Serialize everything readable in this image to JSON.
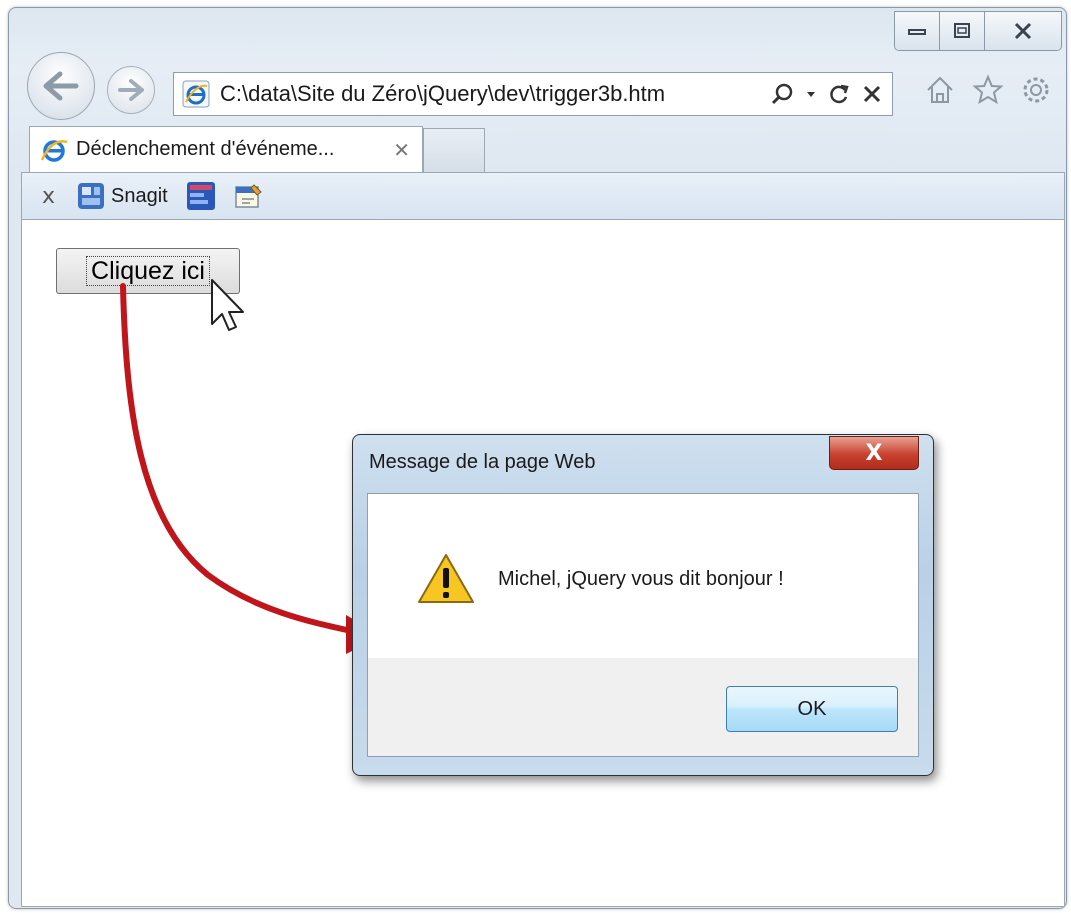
{
  "browser": {
    "address_url": "C:\\data\\Site du Zéro\\jQuery\\dev\\trigger3b.htm",
    "tab_title": "Déclenchement d'événeme...",
    "tab_close": "✕",
    "caption": {
      "minimize": "—",
      "restore": "▢",
      "close": "✕"
    },
    "icons": [
      "back-icon",
      "forward-icon",
      "ie-icon",
      "search-icon",
      "refresh-icon",
      "stop-icon",
      "home-icon",
      "favorites-star-icon",
      "tools-gear-icon"
    ]
  },
  "favorites_bar": {
    "close_label": "x",
    "snagit_label": "Snagit"
  },
  "page": {
    "button_label": "Cliquez ici"
  },
  "dialog": {
    "title": "Message de la page Web",
    "close_label": "X",
    "message": "Michel, jQuery vous dit bonjour !",
    "ok_label": "OK",
    "icon": "warning-icon"
  },
  "colors": {
    "annotation_arrow": "#c0151b",
    "dialog_close": "#c8412f",
    "ok_border": "#3c7fb1"
  }
}
